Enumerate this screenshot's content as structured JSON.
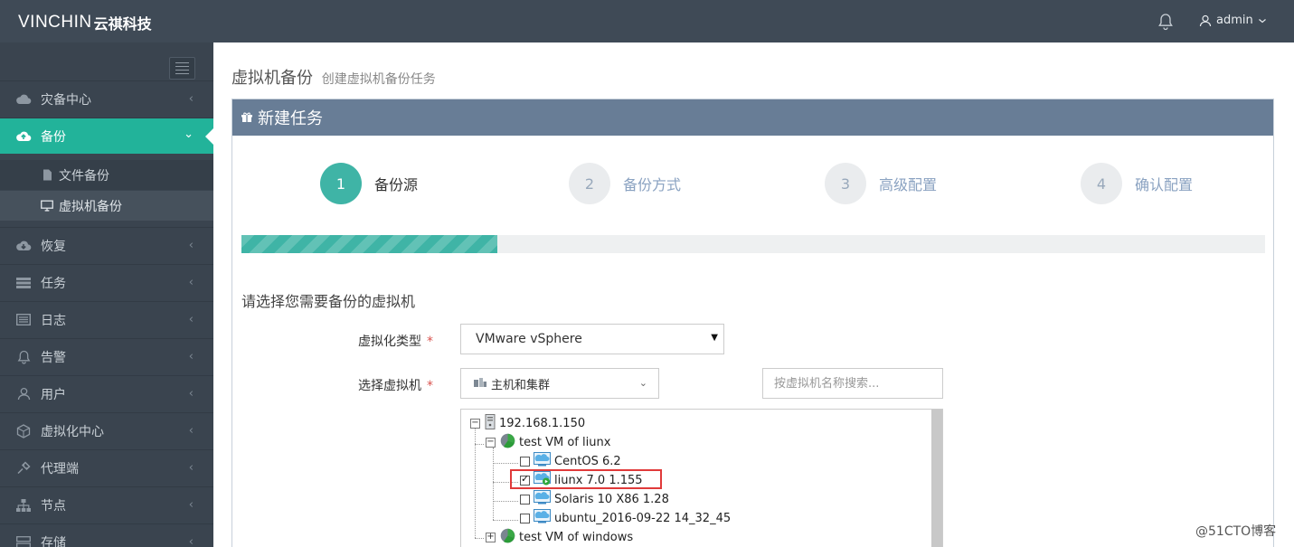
{
  "brand": {
    "name": "VINCHIN",
    "name_cn": "云祺科技"
  },
  "topbar": {
    "user": "admin"
  },
  "sidebar": {
    "items": [
      {
        "label": "灾备中心",
        "icon": "cloud-icon"
      },
      {
        "label": "备份",
        "icon": "cloud-upload-icon"
      },
      {
        "label": "恢复",
        "icon": "cloud-download-icon"
      },
      {
        "label": "任务",
        "icon": "tasks-icon"
      },
      {
        "label": "日志",
        "icon": "log-icon"
      },
      {
        "label": "告警",
        "icon": "bell-icon"
      },
      {
        "label": "用户",
        "icon": "user-icon"
      },
      {
        "label": "虚拟化中心",
        "icon": "cube-icon"
      },
      {
        "label": "代理端",
        "icon": "plug-icon"
      },
      {
        "label": "节点",
        "icon": "sitemap-icon"
      },
      {
        "label": "存储",
        "icon": "storage-icon"
      }
    ],
    "sub_items": [
      {
        "label": "文件备份",
        "icon": "file-icon"
      },
      {
        "label": "虚拟机备份",
        "icon": "monitor-icon"
      }
    ]
  },
  "page": {
    "title": "虚拟机备份",
    "subtitle": "创建虚拟机备份任务"
  },
  "panel": {
    "title": "新建任务"
  },
  "steps": [
    {
      "num": "1",
      "label": "备份源"
    },
    {
      "num": "2",
      "label": "备份方式"
    },
    {
      "num": "3",
      "label": "高级配置"
    },
    {
      "num": "4",
      "label": "确认配置"
    }
  ],
  "progress": {
    "fraction": 0.25
  },
  "form": {
    "section_title": "请选择您需要备份的虚拟机",
    "virt_type_label": "虚拟化类型",
    "virt_type_value": "VMware vSphere",
    "vm_select_label": "选择虚拟机",
    "vm_select_value": "主机和集群",
    "search_placeholder": "按虚拟机名称搜索..."
  },
  "tree": {
    "host": "192.168.1.150",
    "groups": [
      {
        "name": "test VM of liunx",
        "vms": [
          {
            "name": "CentOS 6.2",
            "checked": false
          },
          {
            "name": "liunx 7.0 1.155",
            "checked": true
          },
          {
            "name": "Solaris 10 X86 1.28",
            "checked": false
          },
          {
            "name": "ubuntu_2016-09-22 14_32_45",
            "checked": false
          }
        ]
      },
      {
        "name": "test VM of windows"
      }
    ]
  },
  "watermark": "@51CTO博客"
}
